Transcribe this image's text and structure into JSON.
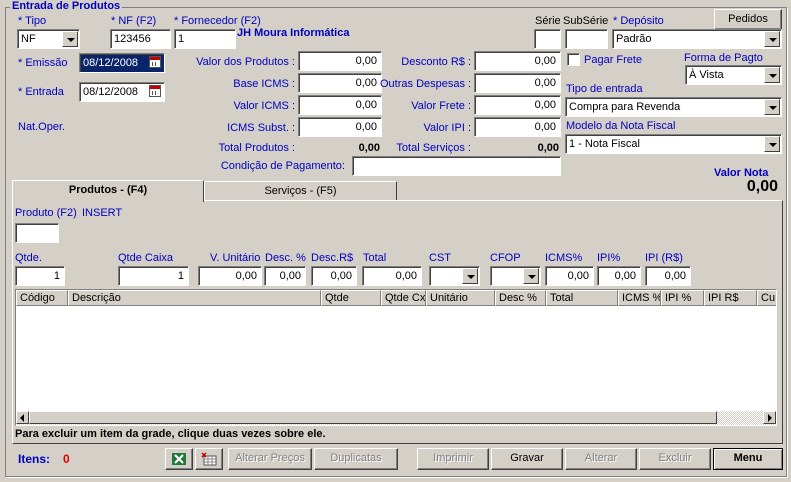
{
  "form": {
    "title": "Entrada de Produtos",
    "pedidos_button": "Pedidos"
  },
  "header": {
    "tipo": {
      "label": "* Tipo",
      "value": "NF"
    },
    "nf": {
      "label": "* NF (F2)",
      "value": "123456"
    },
    "fornecedor": {
      "label": "* Fornecedor (F2)",
      "value": "1",
      "name": "JH Moura Informática"
    },
    "serie": {
      "label": "Série",
      "value": ""
    },
    "subserie": {
      "label": "SubSérie",
      "value": ""
    },
    "deposito": {
      "label": "* Depósito",
      "value": "Padrão"
    },
    "emissao": {
      "label": "* Emissão",
      "value": "08/12/2008"
    },
    "entrada": {
      "label": "* Entrada",
      "value": "08/12/2008"
    },
    "nat_oper": {
      "label": "Nat.Oper."
    }
  },
  "totals": {
    "valor_produtos": {
      "label": "Valor dos Produtos :",
      "value": "0,00"
    },
    "base_icms": {
      "label": "Base ICMS :",
      "value": "0,00"
    },
    "valor_icms": {
      "label": "Valor ICMS :",
      "value": "0,00"
    },
    "icms_subst": {
      "label": "ICMS Subst. :",
      "value": "0,00"
    },
    "total_produtos": {
      "label": "Total Produtos :",
      "value": "0,00"
    },
    "desconto": {
      "label": "Desconto R$ :",
      "value": "0,00"
    },
    "outras_despesas": {
      "label": "Outras Despesas :",
      "value": "0,00"
    },
    "valor_frete": {
      "label": "Valor Frete :",
      "value": "0,00"
    },
    "valor_ipi": {
      "label": "Valor IPI :",
      "value": "0,00"
    },
    "total_servicos": {
      "label": "Total Serviços :",
      "value": "0,00"
    },
    "condicao_pagamento": {
      "label": "Condição de Pagamento:",
      "value": ""
    }
  },
  "right_panel": {
    "pagar_frete": "Pagar Frete",
    "forma_pagto": {
      "label": "Forma de Pagto",
      "value": "À Vista"
    },
    "tipo_entrada": {
      "label": "Tipo de entrada",
      "value": "Compra para Revenda"
    },
    "modelo_nf": {
      "label": "Modelo da Nota Fiscal",
      "value": "1 - Nota Fiscal"
    },
    "valor_nota": {
      "label": "Valor Nota",
      "value": "0,00"
    }
  },
  "tabs": [
    {
      "label": "Produtos  -  (F4)"
    },
    {
      "label": "Serviços  -  (F5)"
    }
  ],
  "item": {
    "produto": {
      "label": "Produto (F2)",
      "mode": "INSERT",
      "value": ""
    },
    "qtde": {
      "label": "Qtde.",
      "value": "1"
    },
    "qtde_caixa": {
      "label": "Qtde Caixa",
      "value": "1"
    },
    "v_unitario": {
      "label": "V. Unitário",
      "value": "0,00"
    },
    "desc_pct": {
      "label": "Desc. %",
      "value": "0,00"
    },
    "desc_rs": {
      "label": "Desc.R$",
      "value": "0,00"
    },
    "total": {
      "label": "Total",
      "value": "0,00"
    },
    "cst": {
      "label": "CST",
      "value": ""
    },
    "cfop": {
      "label": "CFOP",
      "value": ""
    },
    "icms_pct": {
      "label": "ICMS%",
      "value": "0,00"
    },
    "ipi_pct": {
      "label": "IPI%",
      "value": "0,00"
    },
    "ipi_rs": {
      "label": "IPI (R$)",
      "value": "0,00"
    }
  },
  "grid": {
    "columns": [
      "Código",
      "Descrição",
      "Qtde",
      "Qtde Cx",
      "Unitário",
      "Desc %",
      "Total",
      "ICMS %",
      "IPI %",
      "IPI R$",
      "Cu"
    ],
    "hint": "Para excluir um item da grade, clique duas vezes sobre ele."
  },
  "footer": {
    "itens_label": "Itens:",
    "itens_count": "0",
    "buttons": {
      "alterar_precos": "Alterar Preços",
      "duplicatas": "Duplicatas",
      "imprimir": "Imprimir",
      "gravar": "Gravar",
      "alterar": "Alterar",
      "excluir": "Excluir",
      "menu": "Menu"
    },
    "excel_icon": "excel-icon",
    "export_icon": "export-icon"
  },
  "colors": {
    "label_blue": "#0000c0",
    "count_red": "#e00000",
    "window_bg": "#d4d0c8",
    "selection": "#0a246a"
  }
}
